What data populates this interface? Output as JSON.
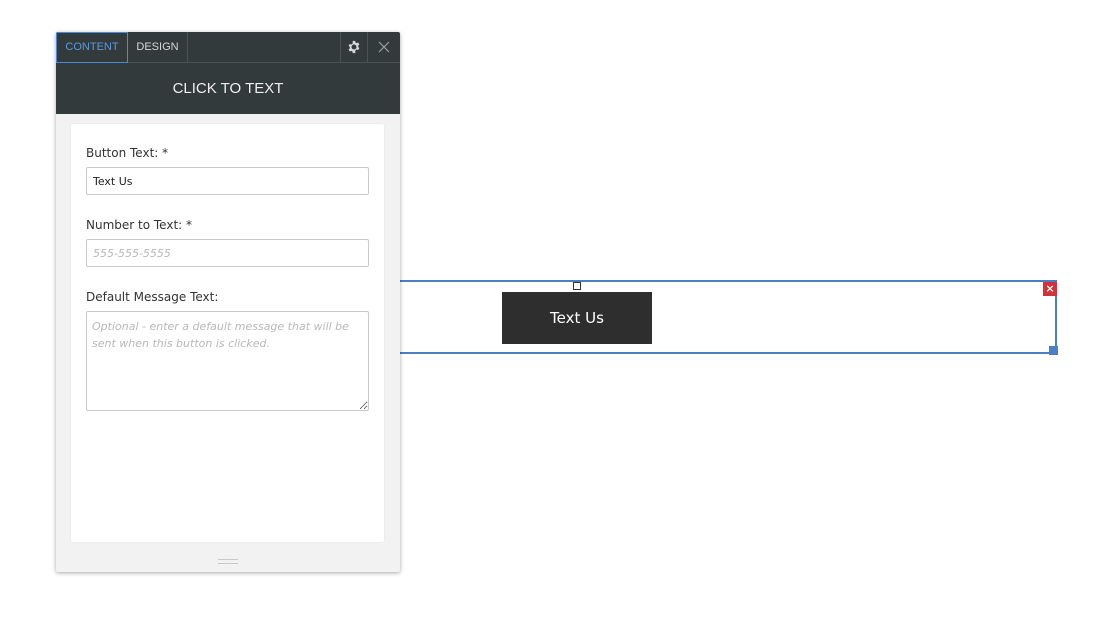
{
  "panel": {
    "tabs": {
      "content": "CONTENT",
      "design": "DESIGN"
    },
    "header_title": "CLICK TO TEXT",
    "icons": {
      "settings": "gear-icon",
      "close": "close-icon"
    },
    "fields": {
      "button_text": {
        "label": "Button Text: *",
        "value": "Text Us"
      },
      "number_to_text": {
        "label": "Number to Text: *",
        "value": "",
        "placeholder": "555-555-5555"
      },
      "default_message": {
        "label": "Default Message Text:",
        "value": "",
        "placeholder": "Optional - enter a default message that will be sent when this button is clicked."
      }
    }
  },
  "canvas": {
    "button_label": "Text Us",
    "delete_glyph": "×"
  },
  "colors": {
    "panel_dark": "#323a3b",
    "active_tab": "#4a8ad6",
    "selection": "#4a7fc1",
    "delete": "#d0343a",
    "button_bg": "#2e2e2e"
  }
}
